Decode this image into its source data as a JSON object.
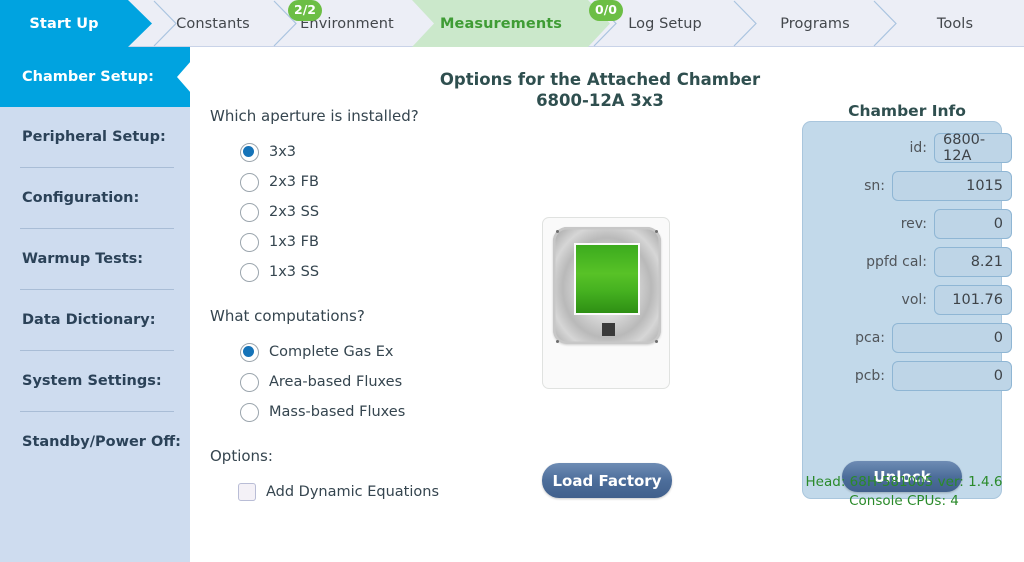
{
  "topnav": {
    "tabs": [
      {
        "label": "Start Up",
        "state": "active"
      },
      {
        "label": "Constants",
        "state": "normal"
      },
      {
        "label": "Environment",
        "state": "normal",
        "badge": "2/2"
      },
      {
        "label": "Measurements",
        "state": "highlight",
        "badge": "0/0"
      },
      {
        "label": "Log Setup",
        "state": "normal"
      },
      {
        "label": "Programs",
        "state": "normal"
      },
      {
        "label": "Tools",
        "state": "normal"
      }
    ],
    "colors": {
      "active_bg": "#00a3e0",
      "highlight_bg": "#cbe8cb",
      "highlight_text": "#3f9c35",
      "badge_bg": "#6cbe45"
    }
  },
  "sidebar": {
    "items": [
      {
        "label": "Chamber Setup:",
        "active": true
      },
      {
        "label": "Peripheral Setup:",
        "active": false
      },
      {
        "label": "Configuration:",
        "active": false
      },
      {
        "label": "Warmup Tests:",
        "active": false
      },
      {
        "label": "Data Dictionary:",
        "active": false
      },
      {
        "label": "System Settings:",
        "active": false
      },
      {
        "label": "Standby/Power Off:",
        "active": false
      }
    ]
  },
  "main": {
    "title_line1": "Options for the Attached Chamber",
    "title_line2": "6800-12A 3x3",
    "aperture_question": "Which aperture is installed?",
    "aperture_options": [
      {
        "label": "3x3",
        "selected": true
      },
      {
        "label": "2x3 FB",
        "selected": false
      },
      {
        "label": "2x3 SS",
        "selected": false
      },
      {
        "label": "1x3 FB",
        "selected": false
      },
      {
        "label": "1x3 SS",
        "selected": false
      }
    ],
    "computation_question": "What computations?",
    "computation_options": [
      {
        "label": "Complete Gas Ex",
        "selected": true
      },
      {
        "label": "Area-based Fluxes",
        "selected": false
      },
      {
        "label": "Mass-based Fluxes",
        "selected": false
      }
    ],
    "options_question": "Options:",
    "option_checkboxes": [
      {
        "label": "Add Dynamic Equations",
        "checked": false
      }
    ],
    "load_factory_label": "Load Factory"
  },
  "chamber_info": {
    "title": "Chamber Info",
    "fields": [
      {
        "label": "id:",
        "value": "6800-12A",
        "width": "narrow"
      },
      {
        "label": "sn:",
        "value": "1015",
        "width": "wide"
      },
      {
        "label": "rev:",
        "value": "0",
        "width": "narrow"
      },
      {
        "label": "ppfd cal:",
        "value": "8.21",
        "width": "narrow"
      },
      {
        "label": "vol:",
        "value": "101.76",
        "width": "narrow"
      },
      {
        "label": "pca:",
        "value": "0",
        "width": "wide"
      },
      {
        "label": "pcb:",
        "value": "0",
        "width": "wide"
      }
    ],
    "unlock_label": "Unlock",
    "head_info": "Head: 68H-581005 ver: 1.4.6",
    "console_info": "Console CPUs: 4"
  }
}
